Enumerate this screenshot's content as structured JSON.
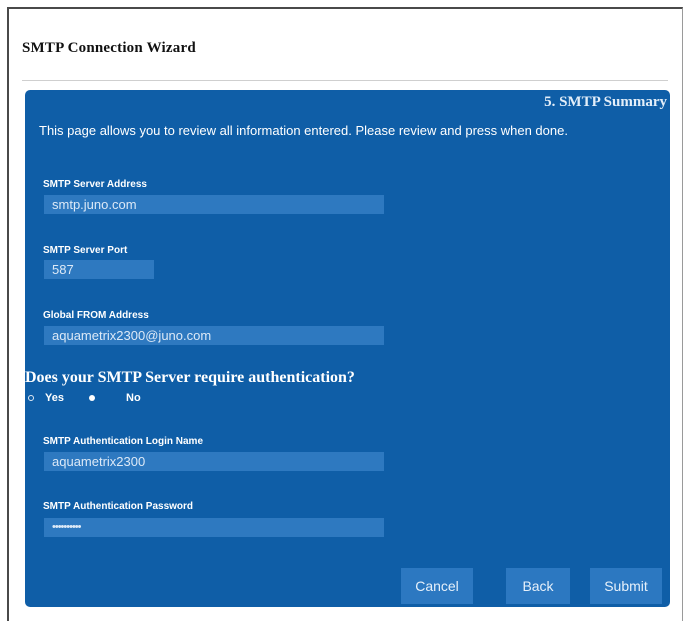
{
  "window": {
    "title": "SMTP Connection Wizard"
  },
  "panel": {
    "step_title": "5. SMTP Summary",
    "intro": "This page allows you to review all information entered. Please review and press when done."
  },
  "fields": {
    "server_address": {
      "label": "SMTP Server Address",
      "value": "smtp.juno.com"
    },
    "server_port": {
      "label": "SMTP Server Port",
      "value": "587"
    },
    "from_address": {
      "label": "Global FROM Address",
      "value": "aquametrix2300@juno.com"
    },
    "login_name": {
      "label": "SMTP Authentication Login Name",
      "value": "aquametrix2300"
    },
    "password": {
      "label": "SMTP Authentication Password",
      "value": "••••••••••"
    }
  },
  "authentication": {
    "question": "Does your SMTP Server require authentication?",
    "options": [
      {
        "label": "Yes",
        "selected": false
      },
      {
        "label": "No",
        "selected": true
      }
    ]
  },
  "buttons": {
    "cancel": "Cancel",
    "back": "Back",
    "submit": "Submit"
  },
  "colors": {
    "panel_background": "#0f5ea7",
    "field_background": "#2e79c0",
    "button_background": "#2c78c1"
  }
}
